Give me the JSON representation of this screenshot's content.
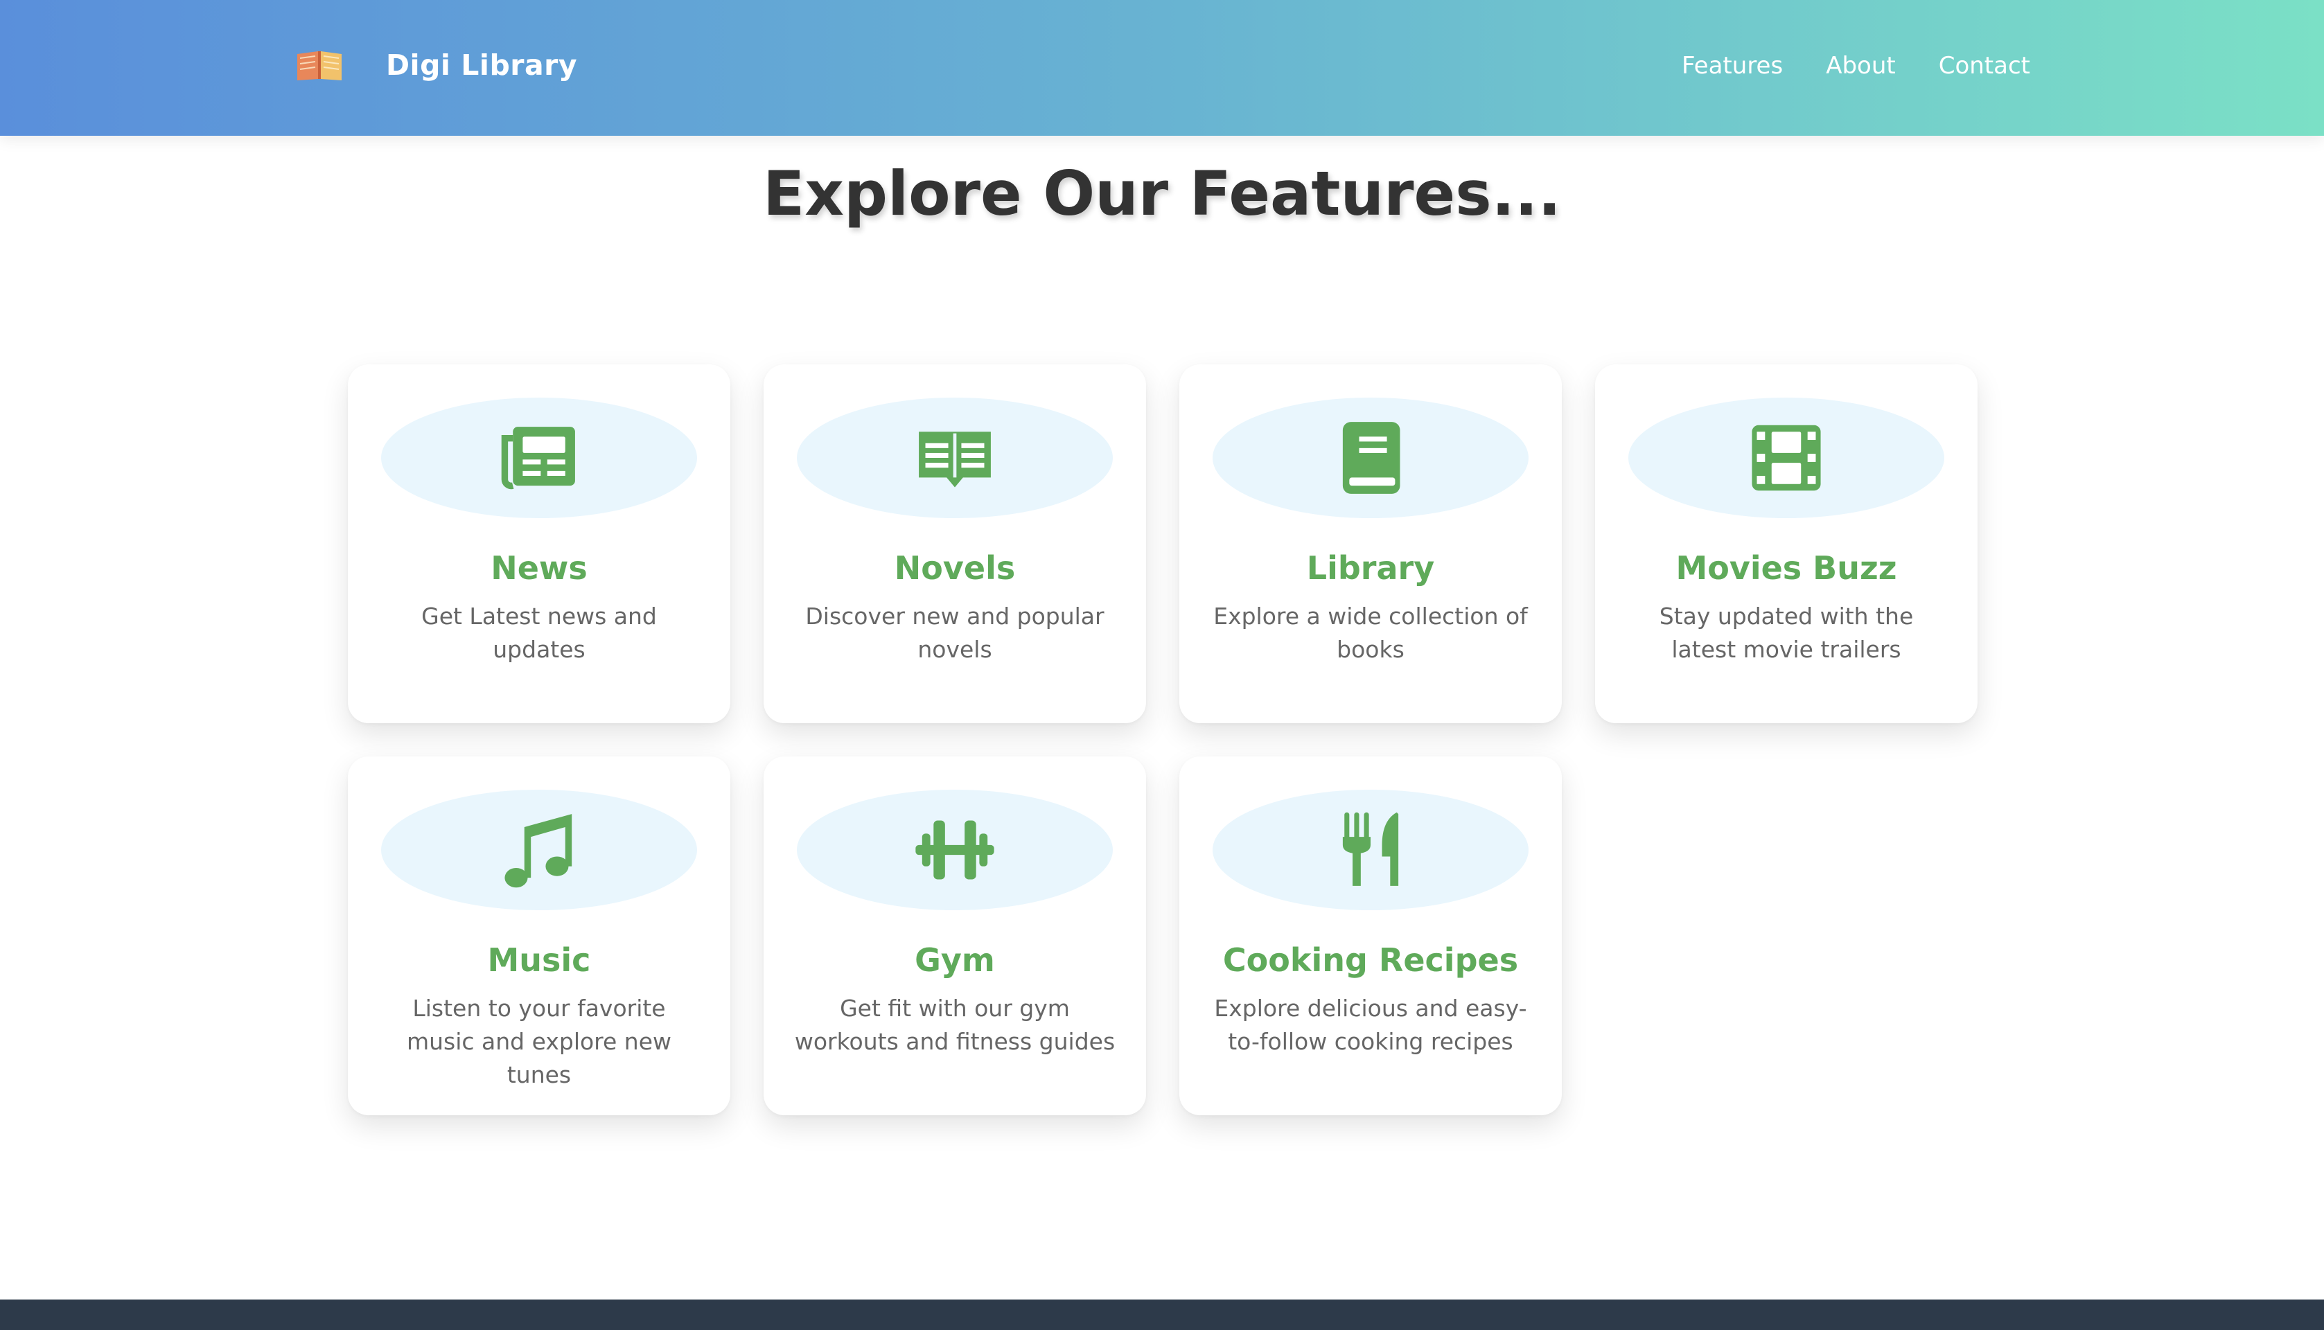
{
  "header": {
    "brand": "Digi Library",
    "logo_icon": "open-book-icon",
    "nav": [
      {
        "label": "Features"
      },
      {
        "label": "About"
      },
      {
        "label": "Contact"
      }
    ]
  },
  "main": {
    "heading": "Explore Our Features..."
  },
  "features": [
    {
      "title": "News",
      "description": "Get Latest news and updates",
      "icon": "newspaper-icon"
    },
    {
      "title": "Novels",
      "description": "Discover new and popular novels",
      "icon": "book-open-reader-icon"
    },
    {
      "title": "Library",
      "description": "Explore a wide collection of books",
      "icon": "book-icon"
    },
    {
      "title": "Movies Buzz",
      "description": "Stay updated with the latest movie trailers",
      "icon": "film-icon"
    },
    {
      "title": "Music",
      "description": "Listen to your favorite music and explore new tunes",
      "icon": "music-note-icon"
    },
    {
      "title": "Gym",
      "description": "Get fit with our gym workouts and fitness guides",
      "icon": "dumbbell-icon"
    },
    {
      "title": "Cooking Recipes",
      "description": "Explore delicious and easy-to-follow cooking recipes",
      "icon": "utensils-icon"
    }
  ],
  "colors": {
    "header_gradient_start": "#5a8fdb",
    "header_gradient_end": "#7be0c6",
    "accent_green": "#5faa5a",
    "icon_bg": "#e9f6fd",
    "heading_text": "#333333",
    "body_text": "#666666",
    "footer_bg": "#2d3a4a"
  }
}
